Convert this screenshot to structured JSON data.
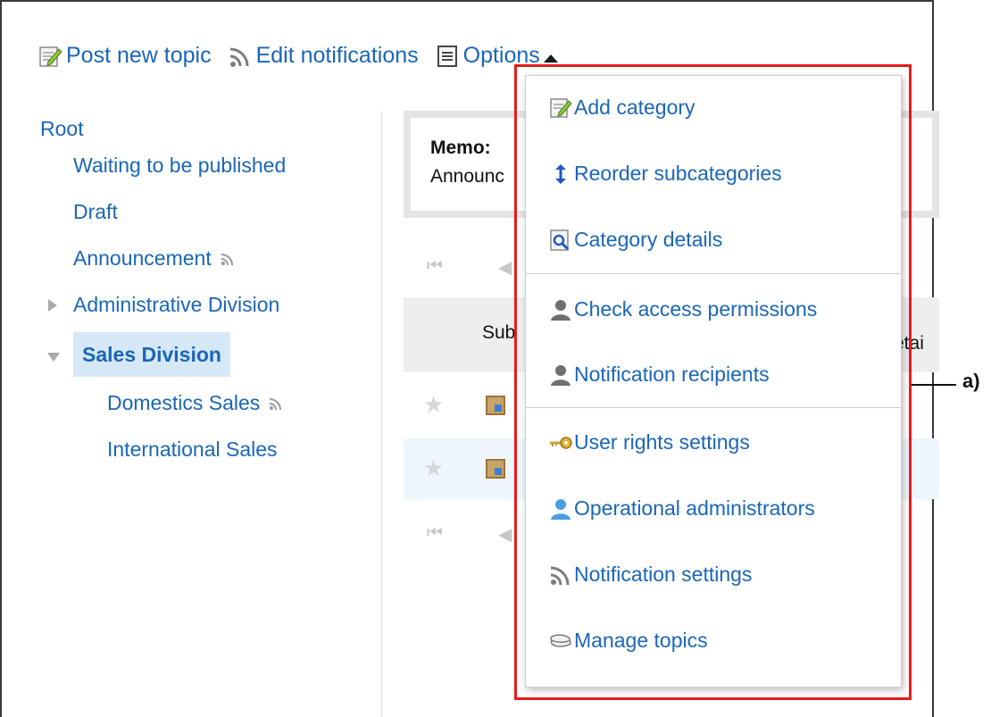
{
  "toolbar": {
    "post_new_topic": "Post new topic",
    "edit_notifications": "Edit notifications",
    "options": "Options"
  },
  "tree": {
    "root": "Root",
    "waiting": "Waiting to be published",
    "draft": "Draft",
    "announcement": "Announcement",
    "administrative": "Administrative Division",
    "sales": "Sales Division",
    "domestics": "Domestics Sales",
    "international": "International Sales"
  },
  "main": {
    "memo_title": "Memo:",
    "memo_text": "Announc",
    "header_subject": "Sub",
    "header_details": "etai"
  },
  "menu": {
    "items": [
      {
        "label": "Add category",
        "icon": "add-category-icon"
      },
      {
        "label": "Reorder subcategories",
        "icon": "reorder-icon"
      },
      {
        "label": "Category details",
        "icon": "category-details-icon"
      },
      {
        "label": "Check access permissions",
        "icon": "user-icon"
      },
      {
        "label": "Notification recipients",
        "icon": "user-icon"
      },
      {
        "label": "User rights settings",
        "icon": "key-icon"
      },
      {
        "label": "Operational administrators",
        "icon": "admin-user-icon"
      },
      {
        "label": "Notification settings",
        "icon": "feed-icon"
      },
      {
        "label": "Manage topics",
        "icon": "manage-topics-icon"
      }
    ]
  },
  "callout": {
    "label": "a)"
  },
  "colors": {
    "link": "#1a66b8",
    "highlight": "#e51c1c",
    "selected_bg": "#d6e8f5"
  }
}
